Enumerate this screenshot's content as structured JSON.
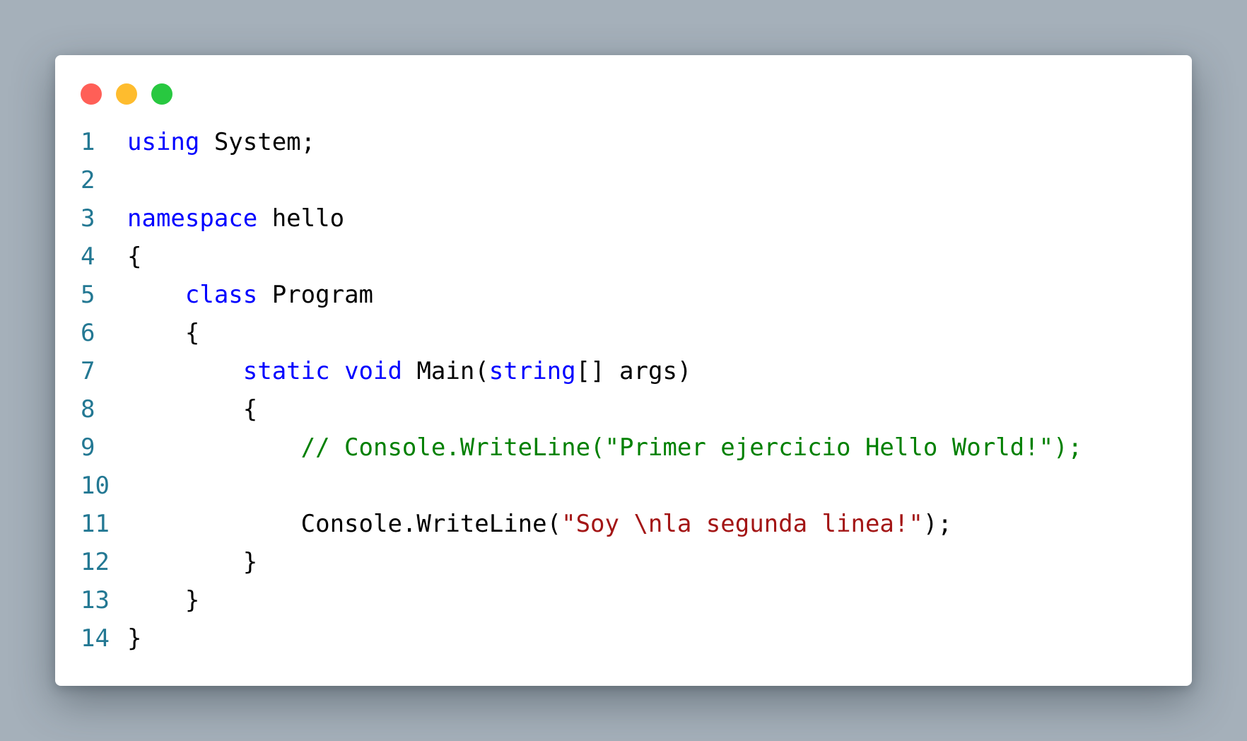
{
  "window": {
    "controls": {
      "close_color": "#ff5f57",
      "minimize_color": "#febc2e",
      "maximize_color": "#28c840"
    }
  },
  "code": {
    "language": "csharp",
    "colors": {
      "keyword": "#0000ff",
      "comment": "#008000",
      "string": "#a31515",
      "plain": "#000000",
      "line_number": "#237893"
    },
    "lines": [
      {
        "number": "1",
        "tokens": [
          {
            "t": "kw",
            "v": "using"
          },
          {
            "t": "pl",
            "v": " System;"
          }
        ]
      },
      {
        "number": "2",
        "tokens": []
      },
      {
        "number": "3",
        "tokens": [
          {
            "t": "kw",
            "v": "namespace"
          },
          {
            "t": "pl",
            "v": " hello"
          }
        ]
      },
      {
        "number": "4",
        "tokens": [
          {
            "t": "pl",
            "v": "{"
          }
        ]
      },
      {
        "number": "5",
        "tokens": [
          {
            "t": "pl",
            "v": "    "
          },
          {
            "t": "kw",
            "v": "class"
          },
          {
            "t": "pl",
            "v": " Program"
          }
        ]
      },
      {
        "number": "6",
        "tokens": [
          {
            "t": "pl",
            "v": "    {"
          }
        ]
      },
      {
        "number": "7",
        "tokens": [
          {
            "t": "pl",
            "v": "        "
          },
          {
            "t": "kw",
            "v": "static"
          },
          {
            "t": "pl",
            "v": " "
          },
          {
            "t": "kw",
            "v": "void"
          },
          {
            "t": "pl",
            "v": " Main("
          },
          {
            "t": "kw",
            "v": "string"
          },
          {
            "t": "pl",
            "v": "[] args)"
          }
        ]
      },
      {
        "number": "8",
        "tokens": [
          {
            "t": "pl",
            "v": "        {"
          }
        ]
      },
      {
        "number": "9",
        "tokens": [
          {
            "t": "pl",
            "v": "            "
          },
          {
            "t": "cm",
            "v": "// Console.WriteLine(\"Primer ejercicio Hello World!\");"
          }
        ]
      },
      {
        "number": "10",
        "tokens": []
      },
      {
        "number": "11",
        "tokens": [
          {
            "t": "pl",
            "v": "            Console.WriteLine("
          },
          {
            "t": "st",
            "v": "\"Soy \\nla segunda linea!\""
          },
          {
            "t": "pl",
            "v": ");"
          }
        ]
      },
      {
        "number": "12",
        "tokens": [
          {
            "t": "pl",
            "v": "        }"
          }
        ]
      },
      {
        "number": "13",
        "tokens": [
          {
            "t": "pl",
            "v": "    }"
          }
        ]
      },
      {
        "number": "14",
        "tokens": [
          {
            "t": "pl",
            "v": "}"
          }
        ]
      }
    ]
  }
}
